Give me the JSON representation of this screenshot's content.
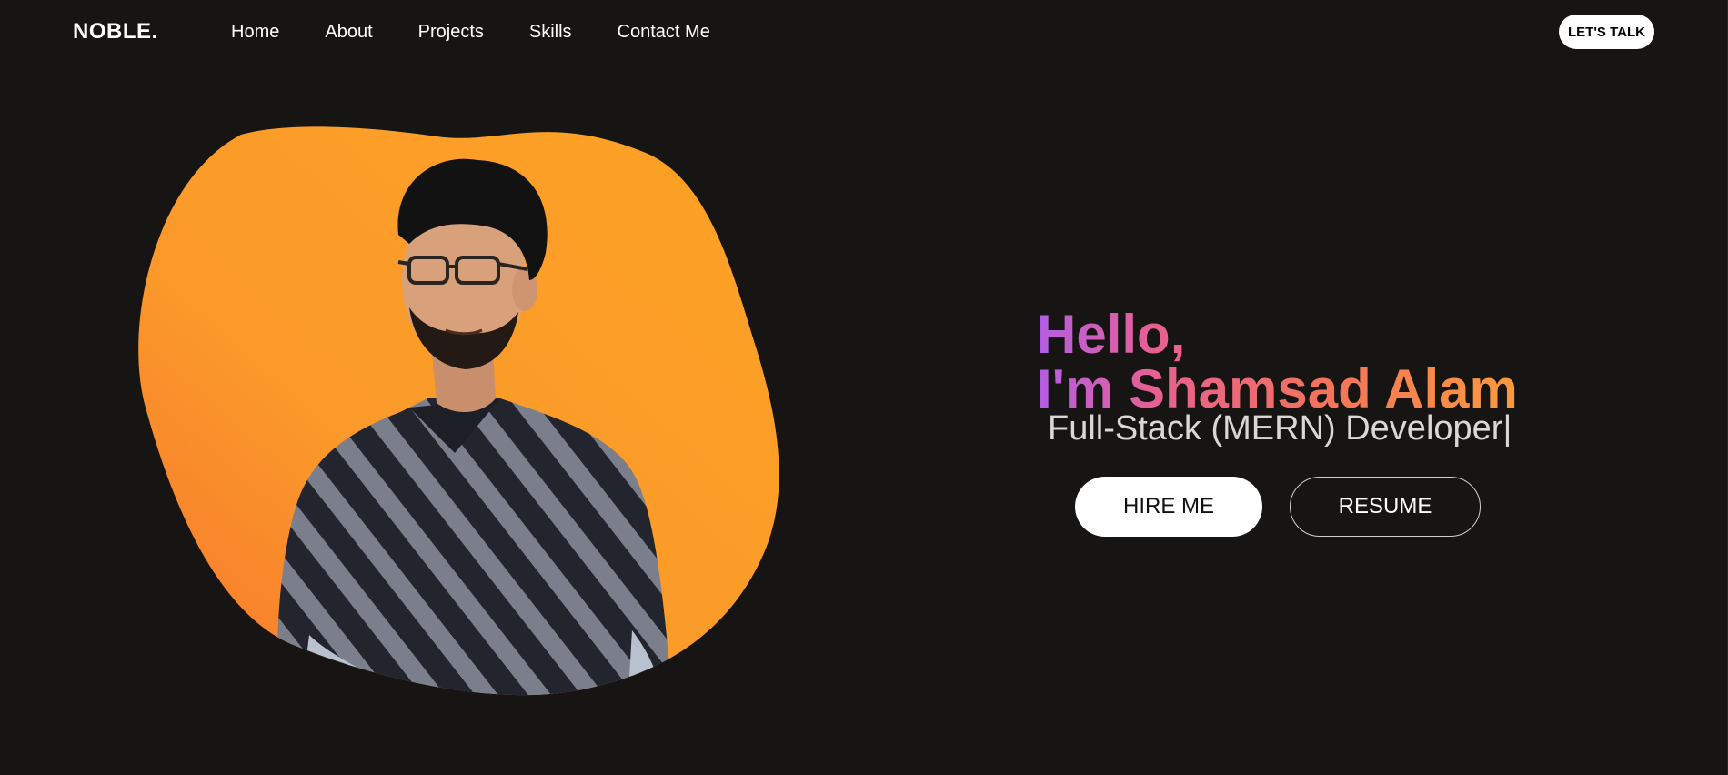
{
  "navbar": {
    "logo": "NOBLE.",
    "links": [
      "Home",
      "About",
      "Projects",
      "Skills",
      "Contact Me"
    ],
    "cta": "LET'S TALK"
  },
  "hero": {
    "greeting_line1": "Hello,",
    "greeting_line2": "I'm Shamsad Alam",
    "subtitle": "Full-Stack (MERN) Developer",
    "cursor": "|",
    "hire_button": "HIRE ME",
    "resume_button": "RESUME"
  },
  "colors": {
    "background": "#171514",
    "blob_orange_light": "#fca224",
    "blob_orange_dark": "#f7762d",
    "gradient_start": "#b35ee6",
    "gradient_end": "#fb9a3c"
  }
}
